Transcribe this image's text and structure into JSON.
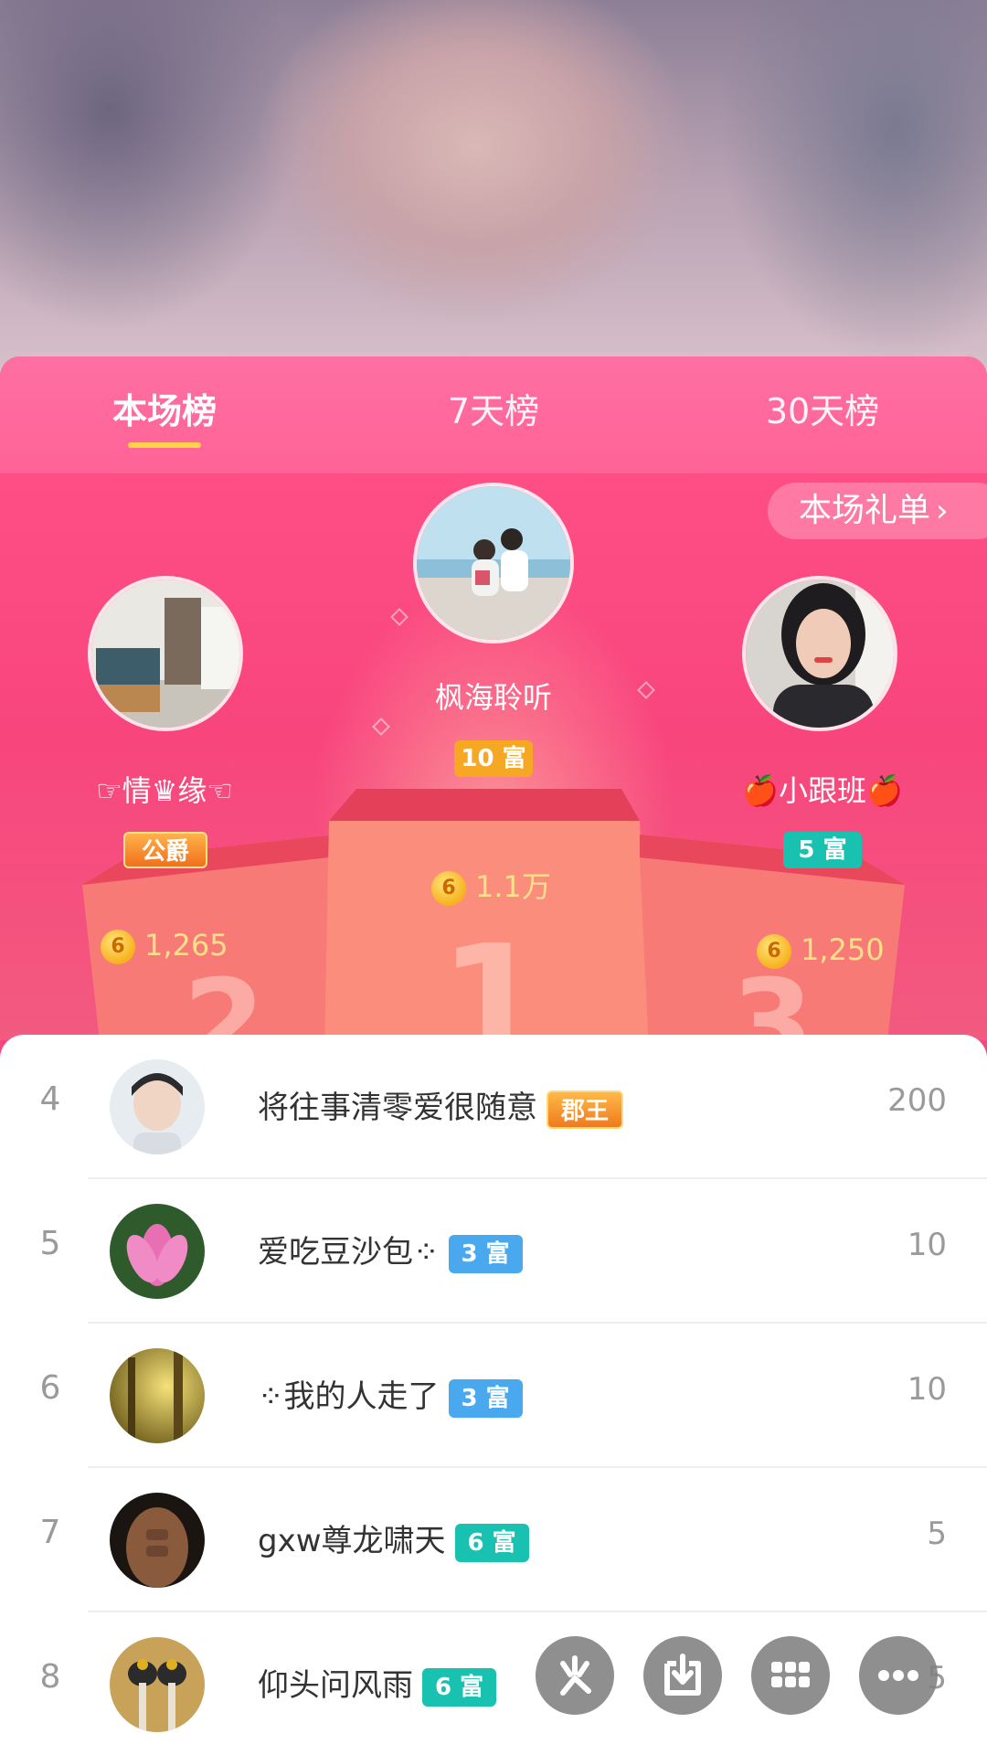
{
  "tabs": [
    {
      "label": "本场榜",
      "active": true
    },
    {
      "label": "7天榜",
      "active": false
    },
    {
      "label": "30天榜",
      "active": false
    }
  ],
  "gift_list_button": {
    "label": "本场礼单",
    "chevron": "›"
  },
  "podium": {
    "first": {
      "rank": "1",
      "name": "枫海聆听",
      "badge": "10 富",
      "amount": "1.1万"
    },
    "second": {
      "rank": "2",
      "name": "☞情♛缘☜",
      "badge": "公爵",
      "amount": "1,265"
    },
    "third": {
      "rank": "3",
      "name": "🍎小跟班🍎",
      "badge": "5 富",
      "amount": "1,250"
    }
  },
  "coin_symbol": "6",
  "list": [
    {
      "rank": "4",
      "name": "将往事清零爱很随意",
      "badge": "郡王",
      "badge_type": "crown",
      "score": "200"
    },
    {
      "rank": "5",
      "name": "爱吃豆沙包⁘",
      "badge": "3 富",
      "badge_type": "blue",
      "score": "10"
    },
    {
      "rank": "6",
      "name": "⁘我的人走了",
      "badge": "3 富",
      "badge_type": "blue",
      "score": "10"
    },
    {
      "rank": "7",
      "name": "gxw尊龙啸天",
      "badge": "6 富",
      "badge_type": "teal",
      "score": "5"
    },
    {
      "rank": "8",
      "name": "仰头问风雨",
      "badge": "6 富",
      "badge_type": "teal",
      "score": "5"
    }
  ],
  "fab_buttons": [
    "sparkle-icon",
    "download-icon",
    "grid-icon",
    "more-icon"
  ],
  "colors": {
    "panel_pink": "#f8457e",
    "tab_underline": "#ffd24a",
    "badge_blue": "#4aa8ee",
    "badge_teal": "#19c2b0",
    "badge_gold": "#f6a723"
  }
}
